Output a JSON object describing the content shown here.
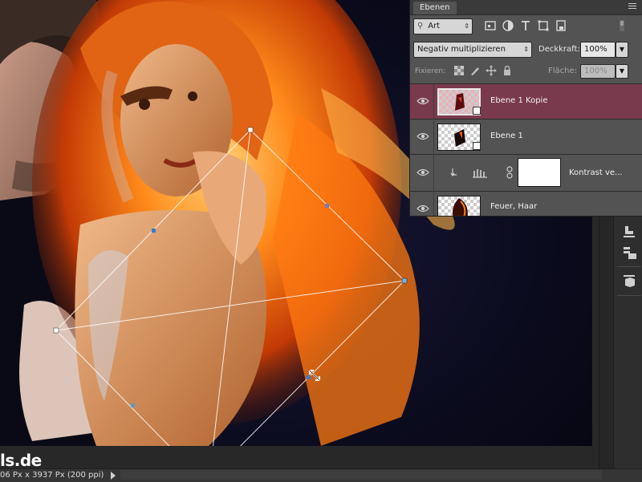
{
  "watermark": "ls.de",
  "status": {
    "doc_info": "06 Px x 3937 Px (200 ppi)",
    "arrow_icon": "triangle-right-icon"
  },
  "panel": {
    "tab_label": "Ebenen",
    "filter": {
      "kind_label": "Art"
    },
    "blend_mode": "Negativ multiplizieren",
    "opacity_label": "Deckkraft:",
    "opacity_value": "100%",
    "lock_label": "Fixieren:",
    "fill_label": "Fläche:",
    "fill_value": "100%"
  },
  "layers": [
    {
      "name": "Ebene 1 Kopie",
      "selected": true,
      "visible": true
    },
    {
      "name": "Ebene 1",
      "selected": false,
      "visible": true
    },
    {
      "name": "Kontrast ve...",
      "selected": false,
      "visible": true,
      "adjustment": true
    },
    {
      "name": "Feuer, Haar",
      "selected": false,
      "visible": true
    }
  ],
  "colors": {
    "selected_layer": "#7a3a4d",
    "panel_bg": "#535353",
    "app_bg": "#282828",
    "fire_orange": "#ff8a1a"
  }
}
